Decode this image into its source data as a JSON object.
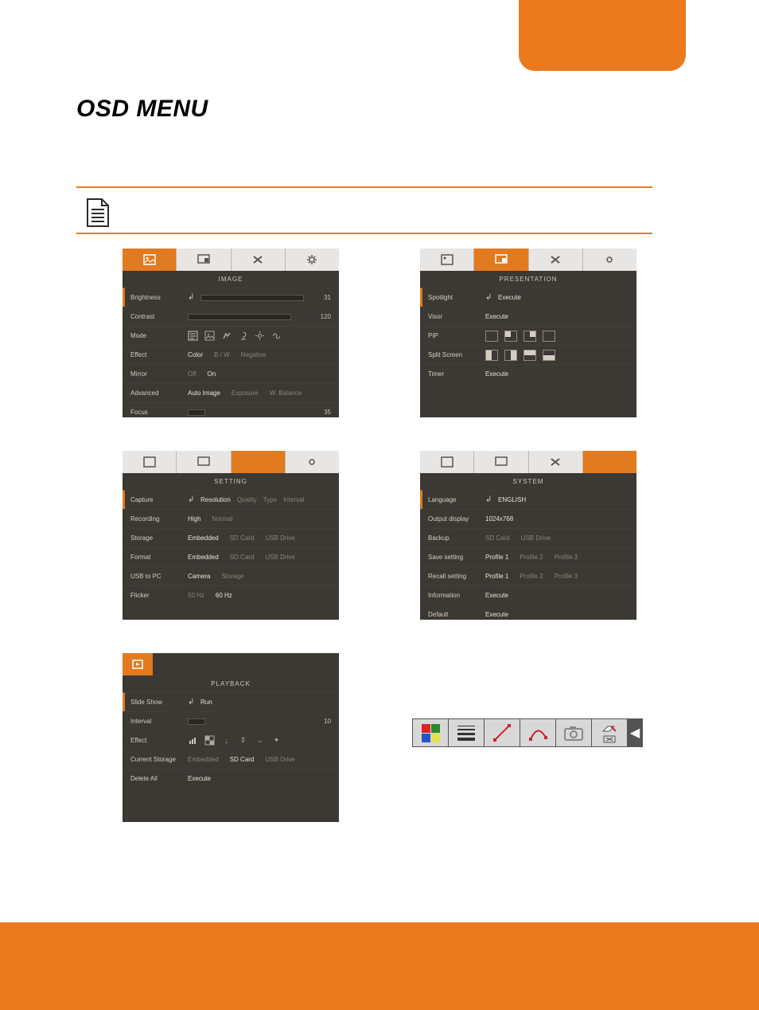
{
  "page": {
    "title": "OSD MENU"
  },
  "panel_image": {
    "title": "IMAGE",
    "tabs": [
      "image-icon",
      "presentation-icon",
      "settings-icon",
      "system-icon"
    ],
    "active_tab": 0,
    "rows": {
      "brightness": {
        "label": "Brightness",
        "value": "31"
      },
      "contrast": {
        "label": "Contrast",
        "value": "120"
      },
      "mode": {
        "label": "Mode"
      },
      "effect": {
        "label": "Effect",
        "opts": [
          "Color",
          "B / W",
          "Negative"
        ],
        "active": 0
      },
      "mirror": {
        "label": "Mirror",
        "opts": [
          "Off",
          "On"
        ],
        "active": 1
      },
      "advanced": {
        "label": "Advanced",
        "opts": [
          "Auto Image",
          "Exposure",
          "W. Balance"
        ],
        "active": 0
      },
      "focus": {
        "label": "Focus",
        "value": "35"
      }
    }
  },
  "panel_presentation": {
    "title": "PRESENTATION",
    "active_tab": 1,
    "rows": {
      "spotlight": {
        "label": "Spotlight",
        "value": "Execute"
      },
      "visor": {
        "label": "Visor",
        "value": "Execute"
      },
      "pip": {
        "label": "PIP"
      },
      "split": {
        "label": "Split Screen"
      },
      "timer": {
        "label": "Timer",
        "value": "Execute"
      }
    }
  },
  "panel_setting": {
    "title": "SETTING",
    "active_tab": 2,
    "rows": {
      "capture": {
        "label": "Capture",
        "opts": [
          "Resolution",
          "Quality",
          "Type",
          "Interval"
        ],
        "active": 0
      },
      "recording": {
        "label": "Recording",
        "opts": [
          "High",
          "Normal"
        ],
        "active": 0
      },
      "storage": {
        "label": "Storage",
        "opts": [
          "Embedded",
          "SD Card",
          "USB Drive"
        ],
        "active": 0
      },
      "format": {
        "label": "Format",
        "opts": [
          "Embedded",
          "SD Card",
          "USB Drive"
        ],
        "active": 0
      },
      "usb2pc": {
        "label": "USB to PC",
        "opts": [
          "Camera",
          "Storage"
        ],
        "active": 0
      },
      "flicker": {
        "label": "Flicker",
        "opts": [
          "50 Hz",
          "60 Hz"
        ],
        "active": 1
      }
    }
  },
  "panel_system": {
    "title": "SYSTEM",
    "active_tab": 3,
    "rows": {
      "language": {
        "label": "Language",
        "value": "ENGLISH"
      },
      "output": {
        "label": "Output display",
        "value": "1024x768"
      },
      "backup": {
        "label": "Backup",
        "opts": [
          "SD Card",
          "USB Drive"
        ]
      },
      "save": {
        "label": "Save setting",
        "opts": [
          "Profile 1",
          "Profile 2",
          "Profile 3"
        ],
        "active": 0
      },
      "recall": {
        "label": "Recall setting",
        "opts": [
          "Profile 1",
          "Profile 2",
          "Profile 3"
        ],
        "active": 0
      },
      "info": {
        "label": "Information",
        "value": "Execute"
      },
      "default": {
        "label": "Default",
        "value": "Execute"
      }
    }
  },
  "panel_playback": {
    "title": "PLAYBACK",
    "rows": {
      "slide": {
        "label": "Slide Show",
        "value": "Run"
      },
      "interval": {
        "label": "Interval",
        "value": "10"
      },
      "effect": {
        "label": "Effect"
      },
      "storage": {
        "label": "Current Storage",
        "opts": [
          "Embedded",
          "SD Card",
          "USB Drive"
        ],
        "active": 1
      },
      "delete": {
        "label": "Delete All",
        "value": "Execute"
      }
    }
  },
  "annotation_bar": {
    "icons": [
      "color-swatch-icon",
      "line-weight-icon",
      "line-tool-icon",
      "curve-tool-icon",
      "camera-icon",
      "eraser-icon",
      "collapse-arrow-icon"
    ]
  }
}
